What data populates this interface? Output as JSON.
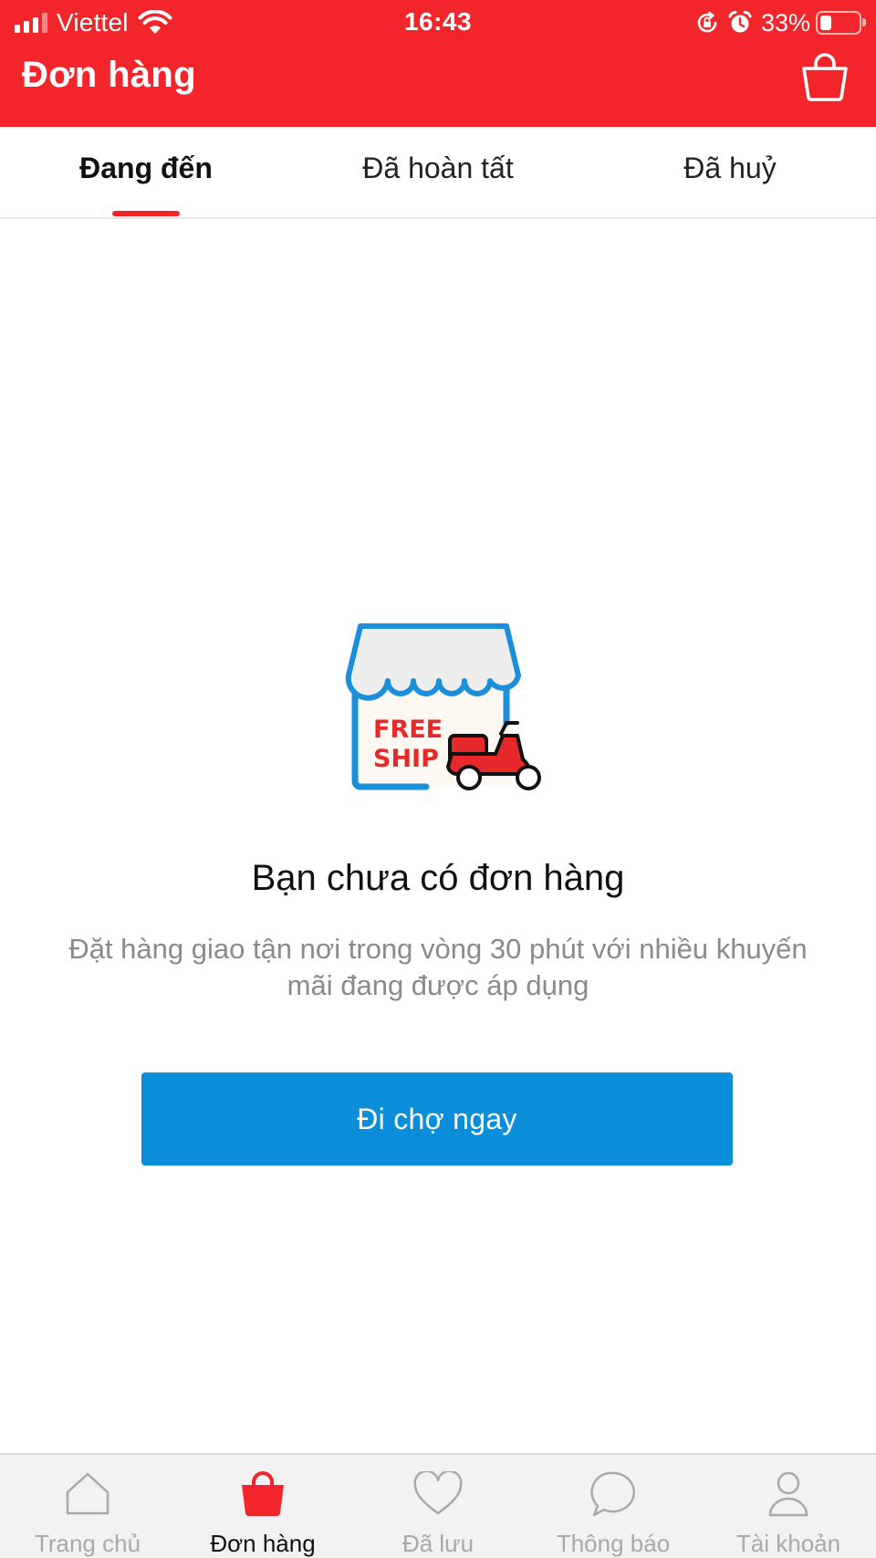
{
  "status_bar": {
    "carrier": "Viettel",
    "time": "16:43",
    "battery_percent": "33%",
    "battery_level": 0.33,
    "icons": [
      "signal-icon",
      "wifi-icon",
      "orientation-lock-icon",
      "alarm-icon",
      "battery-icon"
    ]
  },
  "header": {
    "title": "Đơn hàng",
    "cart_icon": "shopping-bag-icon",
    "background_color": "#f2262a"
  },
  "tabs": [
    {
      "label": "Đang đến",
      "active": true
    },
    {
      "label": "Đã hoàn tất",
      "active": false
    },
    {
      "label": "Đã huỷ",
      "active": false
    }
  ],
  "empty_state": {
    "illustration": {
      "icon": "store-delivery-icon",
      "badge_line1": "FREE",
      "badge_line2": "SHIP"
    },
    "title": "Bạn chưa có đơn hàng",
    "description": "Đặt hàng giao tận nơi trong vòng 30 phút với nhiều khuyến mãi đang được áp dụng",
    "cta_label": "Đi chợ ngay",
    "cta_color": "#0b8ed9"
  },
  "bottom_nav": [
    {
      "label": "Trang chủ",
      "icon": "home-icon",
      "active": false
    },
    {
      "label": "Đơn hàng",
      "icon": "shopping-bag-icon",
      "active": true
    },
    {
      "label": "Đã lưu",
      "icon": "heart-icon",
      "active": false
    },
    {
      "label": "Thông báo",
      "icon": "chat-bubble-icon",
      "active": false
    },
    {
      "label": "Tài khoản",
      "icon": "user-icon",
      "active": false
    }
  ],
  "colors": {
    "accent_red": "#f2262a",
    "cta_blue": "#0b8ed9",
    "nav_inactive": "#a9a9a9",
    "illustration_blue": "#1b8fd9"
  }
}
